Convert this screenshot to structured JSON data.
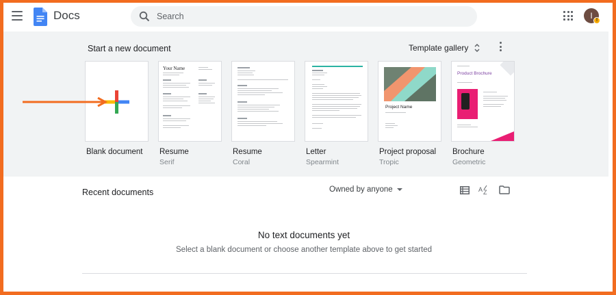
{
  "header": {
    "app_name": "Docs",
    "search_placeholder": "Search",
    "avatar_initial": "I",
    "avatar_badge": "!"
  },
  "templates": {
    "section_title": "Start a new document",
    "gallery_label": "Template gallery",
    "items": [
      {
        "name": "Blank document",
        "sub": ""
      },
      {
        "name": "Resume",
        "sub": "Serif",
        "thumb_title": "Your Name"
      },
      {
        "name": "Resume",
        "sub": "Coral"
      },
      {
        "name": "Letter",
        "sub": "Spearmint"
      },
      {
        "name": "Project proposal",
        "sub": "Tropic",
        "thumb_title": "Project Name"
      },
      {
        "name": "Brochure",
        "sub": "Geometric",
        "thumb_title": "Product Brochure"
      }
    ]
  },
  "recent": {
    "title": "Recent documents",
    "owner_filter": "Owned by anyone",
    "empty_title": "No text documents yet",
    "empty_sub": "Select a blank document or choose another template above to get started"
  },
  "colors": {
    "frame": "#f26c1f",
    "docs_blue": "#4285f4",
    "plus_red": "#ea4335",
    "plus_yellow": "#fbbc04",
    "plus_green": "#34a853"
  }
}
